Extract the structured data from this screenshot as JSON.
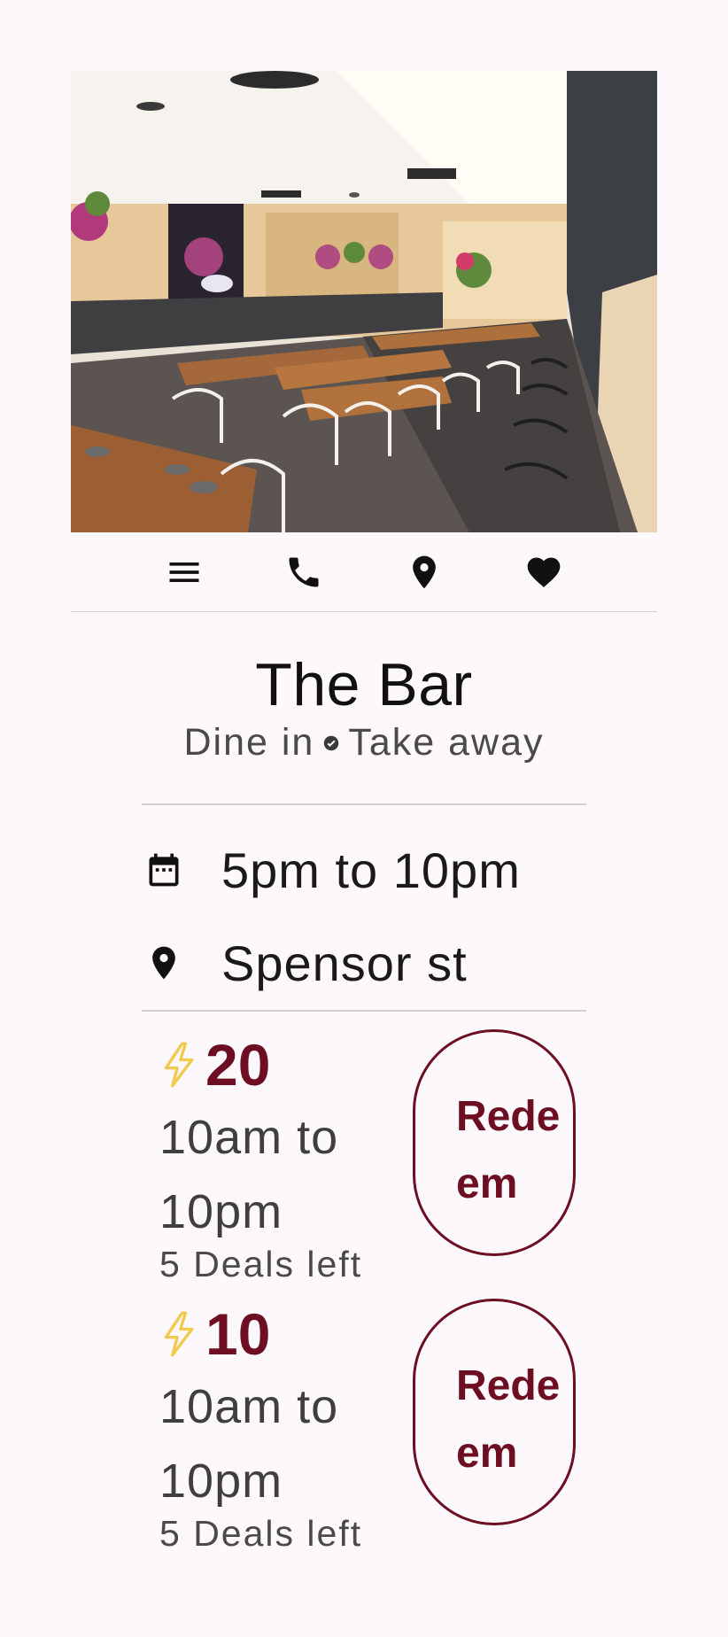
{
  "hero": {
    "image": "restaurant interior photo"
  },
  "actions": [
    {
      "name": "menu",
      "icon": "menu-icon"
    },
    {
      "name": "call",
      "icon": "phone-icon"
    },
    {
      "name": "location",
      "icon": "location-pin-icon"
    },
    {
      "name": "favorite",
      "icon": "heart-icon"
    }
  ],
  "restaurant": {
    "name": "The Bar",
    "service_a": "Dine in",
    "service_b": "Take away",
    "hours": "5pm to 10pm",
    "address": "Spensor st"
  },
  "deals": [
    {
      "amount": "20",
      "hours": "10am to 10pm",
      "left": "5 Deals left",
      "button": "Redeem"
    },
    {
      "amount": "10",
      "hours": "10am to 10pm",
      "left": "5 Deals left",
      "button": "Redeem"
    }
  ],
  "colors": {
    "accent": "#6d0e22",
    "bolt": "#f2c94c",
    "background": "#fdf8fb"
  }
}
